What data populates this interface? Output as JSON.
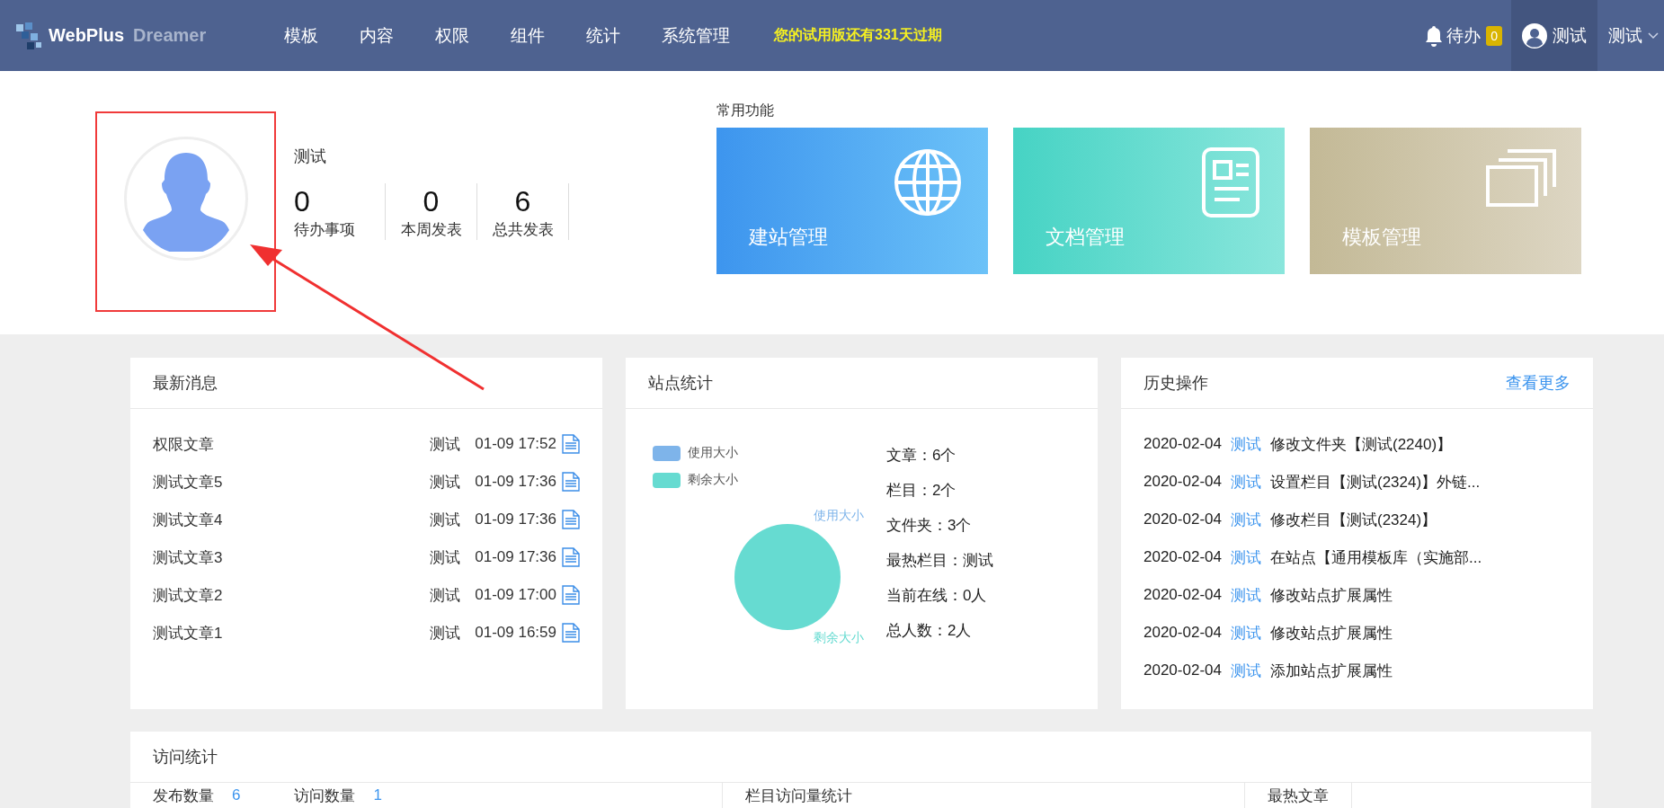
{
  "header": {
    "logo": {
      "brand": "WebPlus",
      "product": "Dreamer"
    },
    "nav": [
      {
        "label": "模板"
      },
      {
        "label": "内容"
      },
      {
        "label": "权限"
      },
      {
        "label": "组件"
      },
      {
        "label": "统计"
      },
      {
        "label": "系统管理"
      }
    ],
    "trial_notice": "您的试用版还有331天过期",
    "todo": {
      "label": "待办",
      "count": "0"
    },
    "user": {
      "name": "测试",
      "selected": true
    },
    "account_menu": {
      "label": "测试"
    }
  },
  "profile": {
    "name": "测试",
    "stats": [
      {
        "value": "0",
        "label": "待办事项"
      },
      {
        "value": "0",
        "label": "本周发表"
      },
      {
        "value": "6",
        "label": "总共发表"
      }
    ]
  },
  "shortcuts": {
    "title": "常用功能",
    "tiles": [
      {
        "label": "建站管理",
        "kind": "globe",
        "color": "#3d95ee"
      },
      {
        "label": "文档管理",
        "kind": "document",
        "color": "#46d3c4"
      },
      {
        "label": "模板管理",
        "kind": "windows",
        "color": "#c3b996"
      }
    ]
  },
  "news": {
    "title": "最新消息",
    "rows": [
      {
        "title": "权限文章",
        "author": "测试",
        "time": "01-09 17:52"
      },
      {
        "title": "测试文章5",
        "author": "测试",
        "time": "01-09 17:36"
      },
      {
        "title": "测试文章4",
        "author": "测试",
        "time": "01-09 17:36"
      },
      {
        "title": "测试文章3",
        "author": "测试",
        "time": "01-09 17:36"
      },
      {
        "title": "测试文章2",
        "author": "测试",
        "time": "01-09 17:00"
      },
      {
        "title": "测试文章1",
        "author": "测试",
        "time": "01-09 16:59"
      }
    ]
  },
  "site_stats": {
    "title": "站点统计",
    "legend": [
      {
        "label": "使用大小",
        "color": "#7eb4ea"
      },
      {
        "label": "剩余大小",
        "color": "#66dbd1"
      }
    ],
    "pie_labels": [
      "使用大小",
      "剩余大小"
    ],
    "facts": [
      "文章：6个",
      "栏目：2个",
      "文件夹：3个",
      "最热栏目：测试",
      "当前在线：0人",
      "总人数：2人"
    ]
  },
  "history": {
    "title": "历史操作",
    "more": "查看更多",
    "rows": [
      {
        "date": "2020-02-04",
        "user": "测试",
        "action": "修改文件夹【测试(2240)】"
      },
      {
        "date": "2020-02-04",
        "user": "测试",
        "action": "设置栏目【测试(2324)】外链..."
      },
      {
        "date": "2020-02-04",
        "user": "测试",
        "action": "修改栏目【测试(2324)】"
      },
      {
        "date": "2020-02-04",
        "user": "测试",
        "action": "在站点【通用模板库（实施部..."
      },
      {
        "date": "2020-02-04",
        "user": "测试",
        "action": "修改站点扩展属性"
      },
      {
        "date": "2020-02-04",
        "user": "测试",
        "action": "修改站点扩展属性"
      },
      {
        "date": "2020-02-04",
        "user": "测试",
        "action": "添加站点扩展属性"
      }
    ]
  },
  "visits": {
    "title": "访问统计",
    "columns": [
      {
        "items": [
          {
            "label": "发布数量",
            "value": "6"
          },
          {
            "label": "访问数量",
            "value": "1"
          }
        ]
      },
      {
        "title": "栏目访问量统计"
      },
      {
        "title": "最热文章"
      }
    ]
  }
}
